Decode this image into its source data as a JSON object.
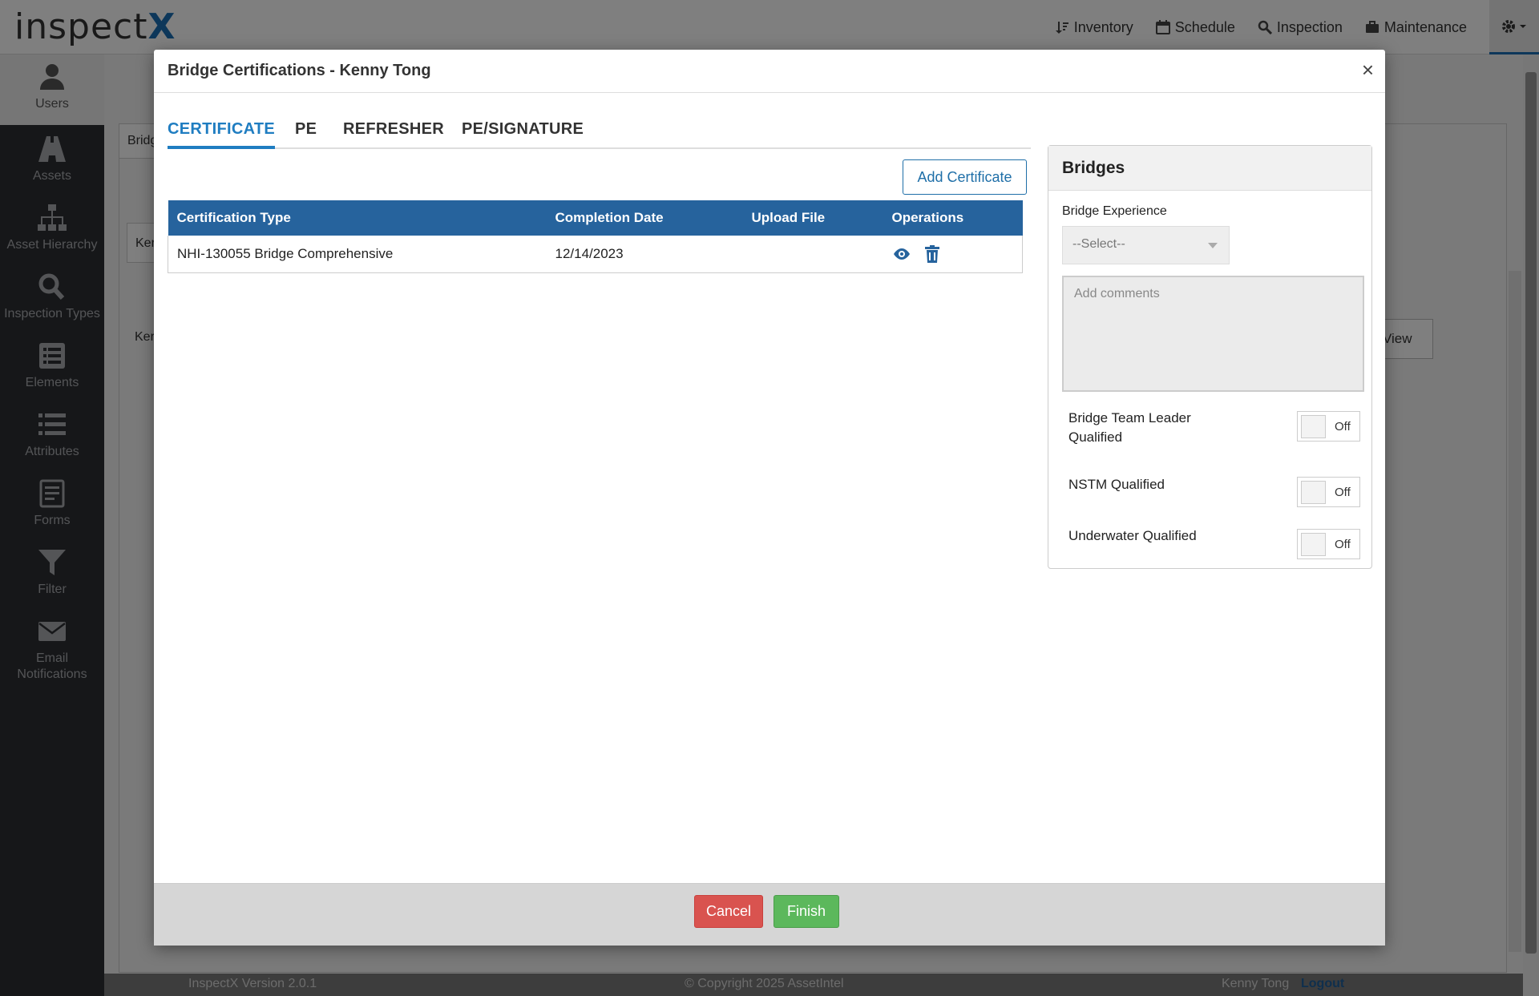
{
  "header": {
    "logo_text": "inspect",
    "logo_x": "X",
    "nav": [
      {
        "label": "Inventory",
        "icon": "sort-icon"
      },
      {
        "label": "Schedule",
        "icon": "calendar-icon"
      },
      {
        "label": "Inspection",
        "icon": "search-icon"
      },
      {
        "label": "Maintenance",
        "icon": "toolbox-icon"
      }
    ]
  },
  "sidebar": {
    "items": [
      {
        "label": "Users",
        "icon": "user-icon",
        "active": true
      },
      {
        "label": "Assets",
        "icon": "road-icon"
      },
      {
        "label": "Asset Hierarchy",
        "icon": "sitemap-icon"
      },
      {
        "label": "Inspection Types",
        "icon": "search-icon"
      },
      {
        "label": "Elements",
        "icon": "list-icon"
      },
      {
        "label": "Attributes",
        "icon": "list-ul-icon"
      },
      {
        "label": "Forms",
        "icon": "form-icon"
      },
      {
        "label": "Filter",
        "icon": "filter-icon"
      },
      {
        "label": "Email",
        "label2": "Notifications",
        "icon": "envelope-icon"
      }
    ]
  },
  "background": {
    "tab_text": "Bridg",
    "inner_text": "Ker",
    "row_text": "Ker",
    "view_btn": "View"
  },
  "modal": {
    "title": "Bridge Certifications - Kenny Tong",
    "close": "×",
    "tabs": [
      "CERTIFICATE",
      "PE",
      "REFRESHER",
      "PE/SIGNATURE"
    ],
    "add_button": "Add Certificate",
    "table": {
      "columns": [
        "Certification Type",
        "Completion Date",
        "Upload File",
        "Operations"
      ],
      "rows": [
        {
          "type": "NHI-130055 Bridge Comprehensive",
          "date": "12/14/2023",
          "file": ""
        }
      ]
    },
    "bridges": {
      "title": "Bridges",
      "experience_label": "Bridge Experience",
      "experience_value": "--Select--",
      "comments_placeholder": "Add comments",
      "qualifications": [
        {
          "label": "Bridge Team Leader Qualified",
          "state": "Off"
        },
        {
          "label": "NSTM Qualified",
          "state": "Off"
        },
        {
          "label": "Underwater Qualified",
          "state": "Off"
        }
      ]
    },
    "cancel": "Cancel",
    "finish": "Finish"
  },
  "footer": {
    "version": "InspectX Version 2.0.1",
    "copyright": "© Copyright 2025 AssetIntel",
    "user": "Kenny Tong",
    "logout": "Logout"
  },
  "colors": {
    "accent": "#1f7dc1",
    "table_header": "#26639d",
    "cancel": "#d9534f",
    "finish": "#5cb85c",
    "sidebar": "#2d2f33"
  }
}
